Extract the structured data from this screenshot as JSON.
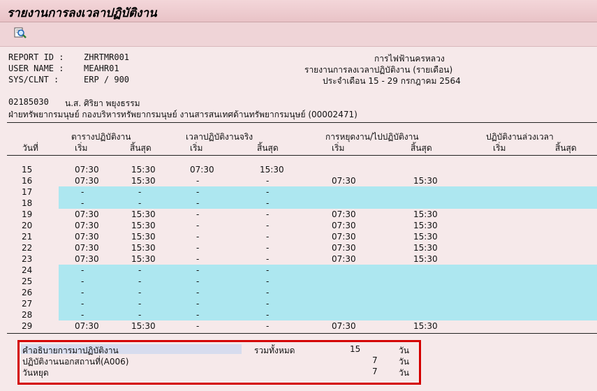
{
  "window": {
    "title": "รายงานการลงเวลาปฏิบัติงาน"
  },
  "toolbar": {
    "icon": "search-icon"
  },
  "report_info": {
    "report_id_label": "REPORT ID :",
    "report_id_value": "ZHRTMR001",
    "user_name_label": "USER NAME :",
    "user_name_value": "MEAHR01",
    "sys_clnt_label": "SYS/CLNT :",
    "sys_clnt_value": "ERP  / 900",
    "org_name": "การไฟฟ้านครหลวง",
    "report_title": "รายงานการลงเวลาปฏิบัติงาน (รายเดือน)",
    "period": "ประจำเดือน 15 - 29 กรกฎาคม 2564"
  },
  "employee": {
    "id": "02185030",
    "name": "น.ส. ศิริยา พยุงธรรม",
    "department": "ฝ่ายทรัพยากรมนุษย์ กองบริหารทรัพยากรมนุษย์ งานสารสนเทศด้านทรัพยากรมนุษย์ (00002471)"
  },
  "table_header": {
    "day": "วันที่",
    "group_schedule": "ตารางปฏิบัติงาน",
    "group_actual": "เวลาปฏิบัติงานจริง",
    "group_leave": "การหยุดงาน/ไปปฏิบัติงาน",
    "group_overtime": "ปฏิบัติงานล่วงเวลา",
    "start": "เริ่ม",
    "end": "สิ้นสุด"
  },
  "rows": [
    {
      "day": "15",
      "s1": "07:30",
      "e1": "15:30",
      "s2": "07:30",
      "e2": "15:30",
      "s3": "",
      "e3": "",
      "hl": false
    },
    {
      "day": "16",
      "s1": "07:30",
      "e1": "15:30",
      "s2": "-",
      "e2": "-",
      "s3": "07:30",
      "e3": "15:30",
      "hl": false
    },
    {
      "day": "17",
      "s1": "-",
      "e1": "-",
      "s2": "-",
      "e2": "-",
      "s3": "",
      "e3": "",
      "hl": true
    },
    {
      "day": "18",
      "s1": "-",
      "e1": "-",
      "s2": "-",
      "e2": "-",
      "s3": "",
      "e3": "",
      "hl": true
    },
    {
      "day": "19",
      "s1": "07:30",
      "e1": "15:30",
      "s2": "-",
      "e2": "-",
      "s3": "07:30",
      "e3": "15:30",
      "hl": false
    },
    {
      "day": "20",
      "s1": "07:30",
      "e1": "15:30",
      "s2": "-",
      "e2": "-",
      "s3": "07:30",
      "e3": "15:30",
      "hl": false
    },
    {
      "day": "21",
      "s1": "07:30",
      "e1": "15:30",
      "s2": "-",
      "e2": "-",
      "s3": "07:30",
      "e3": "15:30",
      "hl": false
    },
    {
      "day": "22",
      "s1": "07:30",
      "e1": "15:30",
      "s2": "-",
      "e2": "-",
      "s3": "07:30",
      "e3": "15:30",
      "hl": false
    },
    {
      "day": "23",
      "s1": "07:30",
      "e1": "15:30",
      "s2": "-",
      "e2": "-",
      "s3": "07:30",
      "e3": "15:30",
      "hl": false
    },
    {
      "day": "24",
      "s1": "-",
      "e1": "-",
      "s2": "-",
      "e2": "-",
      "s3": "",
      "e3": "",
      "hl": true
    },
    {
      "day": "25",
      "s1": "-",
      "e1": "-",
      "s2": "-",
      "e2": "-",
      "s3": "",
      "e3": "",
      "hl": true
    },
    {
      "day": "26",
      "s1": "-",
      "e1": "-",
      "s2": "-",
      "e2": "-",
      "s3": "",
      "e3": "",
      "hl": true
    },
    {
      "day": "27",
      "s1": "-",
      "e1": "-",
      "s2": "-",
      "e2": "-",
      "s3": "",
      "e3": "",
      "hl": true
    },
    {
      "day": "28",
      "s1": "-",
      "e1": "-",
      "s2": "-",
      "e2": "-",
      "s3": "",
      "e3": "",
      "hl": true
    },
    {
      "day": "29",
      "s1": "07:30",
      "e1": "15:30",
      "s2": "-",
      "e2": "-",
      "s3": "07:30",
      "e3": "15:30",
      "hl": false
    }
  ],
  "summary": {
    "line1_label": "คำอธิบายการมาปฏิบัติงาน",
    "total_label": "รวมทั้งหมด",
    "line1_value": "15",
    "line1_unit": "วัน",
    "line2_label": "ปฏิบัติงานนอกสถานที่(A006)",
    "line2_value": "7",
    "line2_unit": "วัน",
    "line3_label": "วันหยุด",
    "line3_value": "7",
    "line3_unit": "วัน"
  }
}
